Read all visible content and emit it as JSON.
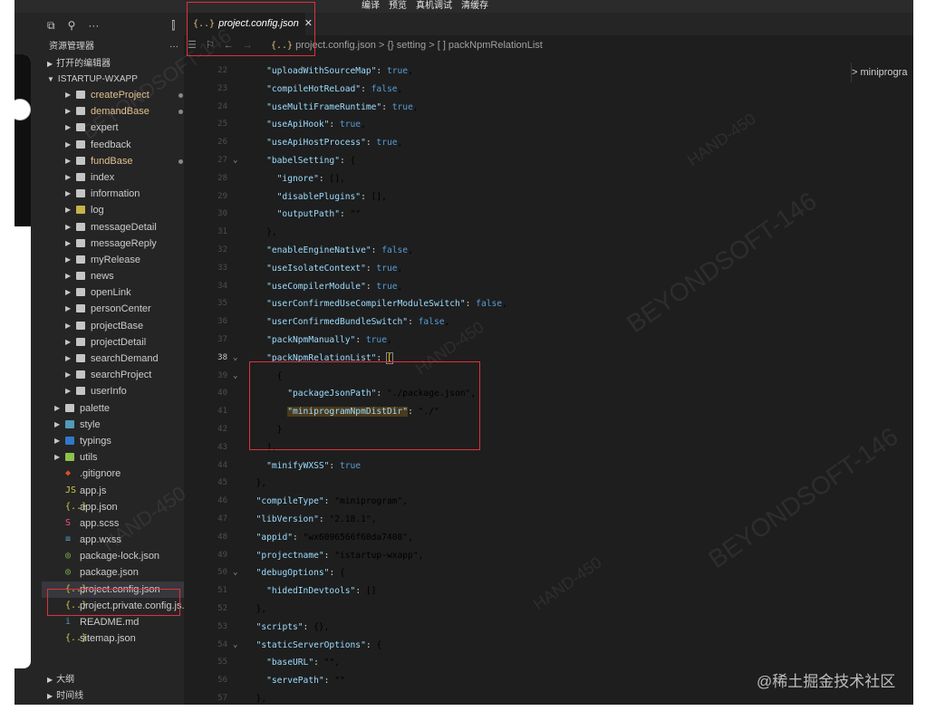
{
  "menu": [
    "编译",
    "预览",
    "真机调试",
    "清缓存"
  ],
  "explorer": {
    "title": "资源管理器",
    "dots": "···",
    "open_editors": "打开的编辑器",
    "project": "ISTARTUP-WXAPP",
    "outline": "大纲",
    "timeline": "时间线"
  },
  "tree": [
    {
      "label": "createProject",
      "type": "folder",
      "depth": 2,
      "color": "#e2c08d",
      "dot": true
    },
    {
      "label": "demandBase",
      "type": "folder",
      "depth": 2,
      "color": "#e2c08d",
      "dot": true
    },
    {
      "label": "expert",
      "type": "folder",
      "depth": 2
    },
    {
      "label": "feedback",
      "type": "folder",
      "depth": 2
    },
    {
      "label": "fundBase",
      "type": "folder",
      "depth": 2,
      "color": "#e2c08d",
      "dot": true
    },
    {
      "label": "index",
      "type": "folder",
      "depth": 2
    },
    {
      "label": "information",
      "type": "folder",
      "depth": 2
    },
    {
      "label": "log",
      "type": "folder",
      "depth": 2,
      "icon_color": "#c4b44a"
    },
    {
      "label": "messageDetail",
      "type": "folder",
      "depth": 2
    },
    {
      "label": "messageReply",
      "type": "folder",
      "depth": 2
    },
    {
      "label": "myRelease",
      "type": "folder",
      "depth": 2
    },
    {
      "label": "news",
      "type": "folder",
      "depth": 2
    },
    {
      "label": "openLink",
      "type": "folder",
      "depth": 2
    },
    {
      "label": "personCenter",
      "type": "folder",
      "depth": 2
    },
    {
      "label": "projectBase",
      "type": "folder",
      "depth": 2
    },
    {
      "label": "projectDetail",
      "type": "folder",
      "depth": 2
    },
    {
      "label": "searchDemand",
      "type": "folder",
      "depth": 2
    },
    {
      "label": "searchProject",
      "type": "folder",
      "depth": 2
    },
    {
      "label": "userInfo",
      "type": "folder",
      "depth": 2
    },
    {
      "label": "palette",
      "type": "folder",
      "depth": 1
    },
    {
      "label": "style",
      "type": "folder",
      "depth": 1,
      "icon_color": "#519aba"
    },
    {
      "label": "typings",
      "type": "folder",
      "depth": 1,
      "icon_color": "#3178c6"
    },
    {
      "label": "utils",
      "type": "folder",
      "depth": 1,
      "icon_color": "#8dc149"
    },
    {
      "label": ".gitignore",
      "type": "file",
      "depth": 1,
      "glyph": "◆",
      "icon_color": "#e44d26"
    },
    {
      "label": "app.js",
      "type": "file",
      "depth": 1,
      "glyph": "JS",
      "icon_color": "#cbcb41"
    },
    {
      "label": "app.json",
      "type": "file",
      "depth": 1,
      "glyph": "{..}",
      "icon_color": "#cbcb41"
    },
    {
      "label": "app.scss",
      "type": "file",
      "depth": 1,
      "glyph": "S",
      "icon_color": "#f55385"
    },
    {
      "label": "app.wxss",
      "type": "file",
      "depth": 1,
      "glyph": "≡",
      "icon_color": "#519aba"
    },
    {
      "label": "package-lock.json",
      "type": "file",
      "depth": 1,
      "glyph": "◎",
      "icon_color": "#8dc149"
    },
    {
      "label": "package.json",
      "type": "file",
      "depth": 1,
      "glyph": "◎",
      "icon_color": "#8dc149"
    },
    {
      "label": "project.config.json",
      "type": "file",
      "depth": 1,
      "glyph": "{..}",
      "icon_color": "#cbcb41",
      "selected": true
    },
    {
      "label": "project.private.config.js...",
      "type": "file",
      "depth": 1,
      "glyph": "{..}",
      "icon_color": "#cbcb41"
    },
    {
      "label": "README.md",
      "type": "file",
      "depth": 1,
      "glyph": "i",
      "icon_color": "#519aba"
    },
    {
      "label": "sitemap.json",
      "type": "file",
      "depth": 1,
      "glyph": "{..}",
      "icon_color": "#cbcb41"
    }
  ],
  "tab": {
    "icon": "{..}",
    "label": "project.config.json",
    "close": "✕"
  },
  "breadcrumb": {
    "icon": "{..}",
    "text": "project.config.json > {} setting > [ ] packNpmRelationList"
  },
  "minimap_label": "> miniprogra",
  "code": [
    {
      "n": "22",
      "t": "    \"uploadWithSourceMap\": true,"
    },
    {
      "n": "23",
      "t": "    \"compileHotReLoad\": false,"
    },
    {
      "n": "24",
      "t": "    \"useMultiFrameRuntime\": true,"
    },
    {
      "n": "25",
      "t": "    \"useApiHook\": true,"
    },
    {
      "n": "26",
      "t": "    \"useApiHostProcess\": true,"
    },
    {
      "n": "27",
      "t": "    \"babelSetting\": {",
      "fold": true
    },
    {
      "n": "28",
      "t": "      \"ignore\": [],"
    },
    {
      "n": "29",
      "t": "      \"disablePlugins\": [],"
    },
    {
      "n": "30",
      "t": "      \"outputPath\": \"\""
    },
    {
      "n": "31",
      "t": "    },"
    },
    {
      "n": "32",
      "t": "    \"enableEngineNative\": false,"
    },
    {
      "n": "33",
      "t": "    \"useIsolateContext\": true,"
    },
    {
      "n": "34",
      "t": "    \"useCompilerModule\": true,"
    },
    {
      "n": "35",
      "t": "    \"userConfirmedUseCompilerModuleSwitch\": false,"
    },
    {
      "n": "36",
      "t": "    \"userConfirmedBundleSwitch\": false,"
    },
    {
      "n": "37",
      "t": "    \"packNpmManually\": true,"
    },
    {
      "n": "38",
      "t": "    \"packNpmRelationList\": [",
      "fold": true,
      "current": true
    },
    {
      "n": "39",
      "t": "      {",
      "fold": true
    },
    {
      "n": "40",
      "t": "        \"packageJsonPath\": \"./package.json\","
    },
    {
      "n": "41",
      "t": "        \"miniprogramNpmDistDir\": \"./\"",
      "highlight": true
    },
    {
      "n": "42",
      "t": "      }"
    },
    {
      "n": "43",
      "t": "    ],"
    },
    {
      "n": "44",
      "t": "    \"minifyWXSS\": true"
    },
    {
      "n": "45",
      "t": "  },"
    },
    {
      "n": "46",
      "t": "  \"compileType\": \"miniprogram\","
    },
    {
      "n": "47",
      "t": "  \"libVersion\": \"2.18.1\","
    },
    {
      "n": "48",
      "t": "  \"appid\": \"wx6096566f60da7408\","
    },
    {
      "n": "49",
      "t": "  \"projectname\": \"istartup-wxapp\","
    },
    {
      "n": "50",
      "t": "  \"debugOptions\": {",
      "fold": true
    },
    {
      "n": "51",
      "t": "    \"hidedInDevtools\": []"
    },
    {
      "n": "52",
      "t": "  },"
    },
    {
      "n": "53",
      "t": "  \"scripts\": {},"
    },
    {
      "n": "54",
      "t": "  \"staticServerOptions\": {",
      "fold": true
    },
    {
      "n": "55",
      "t": "    \"baseURL\": \"\","
    },
    {
      "n": "56",
      "t": "    \"servePath\": \"\""
    },
    {
      "n": "57",
      "t": "  },"
    }
  ],
  "watermarks": [
    "BEYONDSOFT-146",
    "HAND-450"
  ],
  "badge": "@稀土掘金技术社区",
  "colors": {
    "accent_red": "#e0313a",
    "editor_bg": "#1e1e1e",
    "sidebar_bg": "#252526"
  }
}
